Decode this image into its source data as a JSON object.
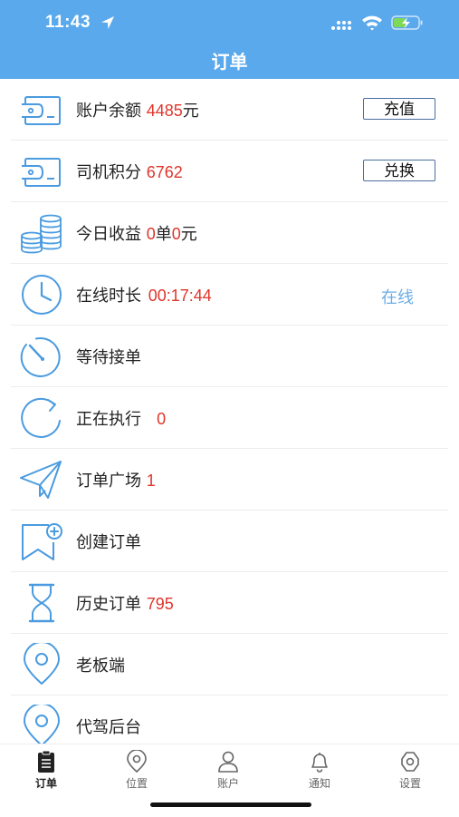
{
  "status": {
    "time": "11:43"
  },
  "header": {
    "title": "订单"
  },
  "colors": {
    "accent": "#5aa9ec",
    "highlight": "#e0352b",
    "icon": "#4a9be0",
    "online": "#6aaee6"
  },
  "rows": [
    {
      "label": "账户余额",
      "value": "4485",
      "suffix": "元",
      "action": "充值",
      "icon": "wallet-icon"
    },
    {
      "label": "司机积分",
      "value": "6762",
      "action": "兑换",
      "icon": "wallet-icon"
    },
    {
      "label": "今日收益",
      "value1": "0",
      "unit1": "单",
      "value2": "0",
      "unit2": "元",
      "icon": "coins-icon"
    },
    {
      "label": "在线时长",
      "value": "00:17:44",
      "status": "在线",
      "icon": "clock-icon"
    },
    {
      "label": "等待接单",
      "icon": "timer-icon"
    },
    {
      "label": "正在执行",
      "value": "0",
      "icon": "refresh-icon"
    },
    {
      "label": "订单广场",
      "value": "1",
      "icon": "paper-plane-icon"
    },
    {
      "label": "创建订单",
      "icon": "bookmark-add-icon"
    },
    {
      "label": "历史订单",
      "value": "795",
      "icon": "hourglass-icon"
    },
    {
      "label": "老板端",
      "icon": "location-pin-icon"
    },
    {
      "label": "代驾后台",
      "icon": "location-pin-icon"
    }
  ],
  "tabs": [
    {
      "label": "订单",
      "icon": "clipboard-icon",
      "active": true
    },
    {
      "label": "位置",
      "icon": "location-pin-icon"
    },
    {
      "label": "账户",
      "icon": "user-icon"
    },
    {
      "label": "通知",
      "icon": "bell-icon"
    },
    {
      "label": "设置",
      "icon": "gear-icon"
    }
  ]
}
